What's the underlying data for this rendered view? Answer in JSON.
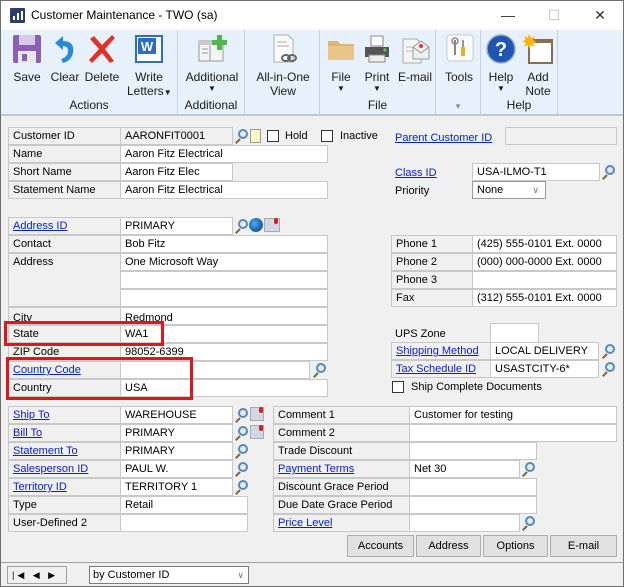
{
  "window": {
    "title": "Customer Maintenance  -  TWO (sa)",
    "controls": {
      "minimize": "—",
      "maximize": "☐",
      "close": "✕"
    }
  },
  "ribbon": {
    "groups": [
      {
        "label": "Actions",
        "buttons": [
          {
            "label": "Save",
            "icon": "save-icon"
          },
          {
            "label": "Clear",
            "icon": "clear-icon"
          },
          {
            "label": "Delete",
            "icon": "delete-icon"
          },
          {
            "label": "Write",
            "label2": "Letters",
            "icon": "word-icon",
            "dropdown": true
          }
        ]
      },
      {
        "label": "Additional",
        "buttons": [
          {
            "label": "Additional",
            "icon": "additional-icon",
            "dropdown": true
          }
        ]
      },
      {
        "label": "",
        "buttons": [
          {
            "label": "All-in-One",
            "label2": "View",
            "icon": "all-in-one-view-icon"
          }
        ]
      },
      {
        "label": "File",
        "buttons": [
          {
            "label": "File",
            "icon": "folder-icon",
            "dropdown": true
          },
          {
            "label": "Print",
            "icon": "printer-icon",
            "dropdown": true
          },
          {
            "label": "E-mail",
            "icon": "email-icon"
          }
        ]
      },
      {
        "label": "▾",
        "buttons": [
          {
            "label": "Tools",
            "icon": "tools-icon"
          }
        ]
      },
      {
        "label": "Help",
        "buttons": [
          {
            "label": "Help",
            "icon": "help-icon",
            "dropdown": true
          },
          {
            "label": "Add",
            "label2": "Note",
            "icon": "add-note-icon"
          }
        ]
      }
    ]
  },
  "form": {
    "customer_id": {
      "label": "Customer ID",
      "value": "AARONFIT0001"
    },
    "hold": {
      "label": "Hold",
      "checked": false
    },
    "inactive": {
      "label": "Inactive",
      "checked": false
    },
    "parent_customer_id": {
      "label": "Parent Customer ID",
      "value": ""
    },
    "name": {
      "label": "Name",
      "value": "Aaron Fitz Electrical"
    },
    "short_name": {
      "label": "Short Name",
      "value": "Aaron Fitz Elec"
    },
    "statement_name": {
      "label": "Statement Name",
      "value": "Aaron Fitz Electrical"
    },
    "class_id": {
      "label": "Class ID",
      "value": "USA-ILMO-T1"
    },
    "priority": {
      "label": "Priority",
      "value": "None"
    },
    "address_id": {
      "label": "Address ID",
      "value": "PRIMARY"
    },
    "contact": {
      "label": "Contact",
      "value": "Bob Fitz"
    },
    "address": {
      "label": "Address",
      "line1": "One Microsoft Way",
      "line2": "",
      "line3": ""
    },
    "city": {
      "label": "City",
      "value": "Redmond"
    },
    "state": {
      "label": "State",
      "value": "WA1"
    },
    "zip": {
      "label": "ZIP Code",
      "value": "98052-6399"
    },
    "country_code": {
      "label": "Country Code",
      "value": ""
    },
    "country": {
      "label": "Country",
      "value": "USA"
    },
    "phone1": {
      "label": "Phone 1",
      "value": "(425) 555-0101  Ext. 0000"
    },
    "phone2": {
      "label": "Phone 2",
      "value": "(000) 000-0000  Ext. 0000"
    },
    "phone3": {
      "label": "Phone 3",
      "value": ""
    },
    "fax": {
      "label": "Fax",
      "value": "(312) 555-0101  Ext. 0000"
    },
    "ups_zone": {
      "label": "UPS Zone",
      "value": ""
    },
    "shipping_method": {
      "label": "Shipping Method",
      "value": "LOCAL DELIVERY"
    },
    "tax_schedule_id": {
      "label": "Tax Schedule ID",
      "value": "USASTCITY-6*"
    },
    "ship_complete": {
      "label": "Ship Complete Documents",
      "checked": false
    },
    "ship_to": {
      "label": "Ship To",
      "value": "WAREHOUSE"
    },
    "bill_to": {
      "label": "Bill To",
      "value": "PRIMARY"
    },
    "statement_to": {
      "label": "Statement To",
      "value": "PRIMARY"
    },
    "salesperson_id": {
      "label": "Salesperson ID",
      "value": "PAUL W."
    },
    "territory_id": {
      "label": "Territory ID",
      "value": "TERRITORY 1"
    },
    "type": {
      "label": "Type",
      "value": "Retail"
    },
    "user_defined_2": {
      "label": "User-Defined 2",
      "value": ""
    },
    "comment1": {
      "label": "Comment 1",
      "value": "Customer for testing"
    },
    "comment2": {
      "label": "Comment 2",
      "value": ""
    },
    "trade_discount": {
      "label": "Trade Discount",
      "value": ""
    },
    "payment_terms": {
      "label": "Payment Terms",
      "value": "Net 30"
    },
    "discount_grace": {
      "label": "Discount Grace Period",
      "value": ""
    },
    "due_date_grace": {
      "label": "Due Date Grace Period",
      "value": ""
    },
    "price_level": {
      "label": "Price Level",
      "value": ""
    }
  },
  "buttons": {
    "accounts": "Accounts",
    "address": "Address",
    "options": "Options",
    "email": "E-mail"
  },
  "footer": {
    "nav": "|◀ ◀ ▶ ▶|",
    "sort_by": "by Customer ID"
  },
  "highlight_color": "#e2141e",
  "link_color": "#0b20c9"
}
